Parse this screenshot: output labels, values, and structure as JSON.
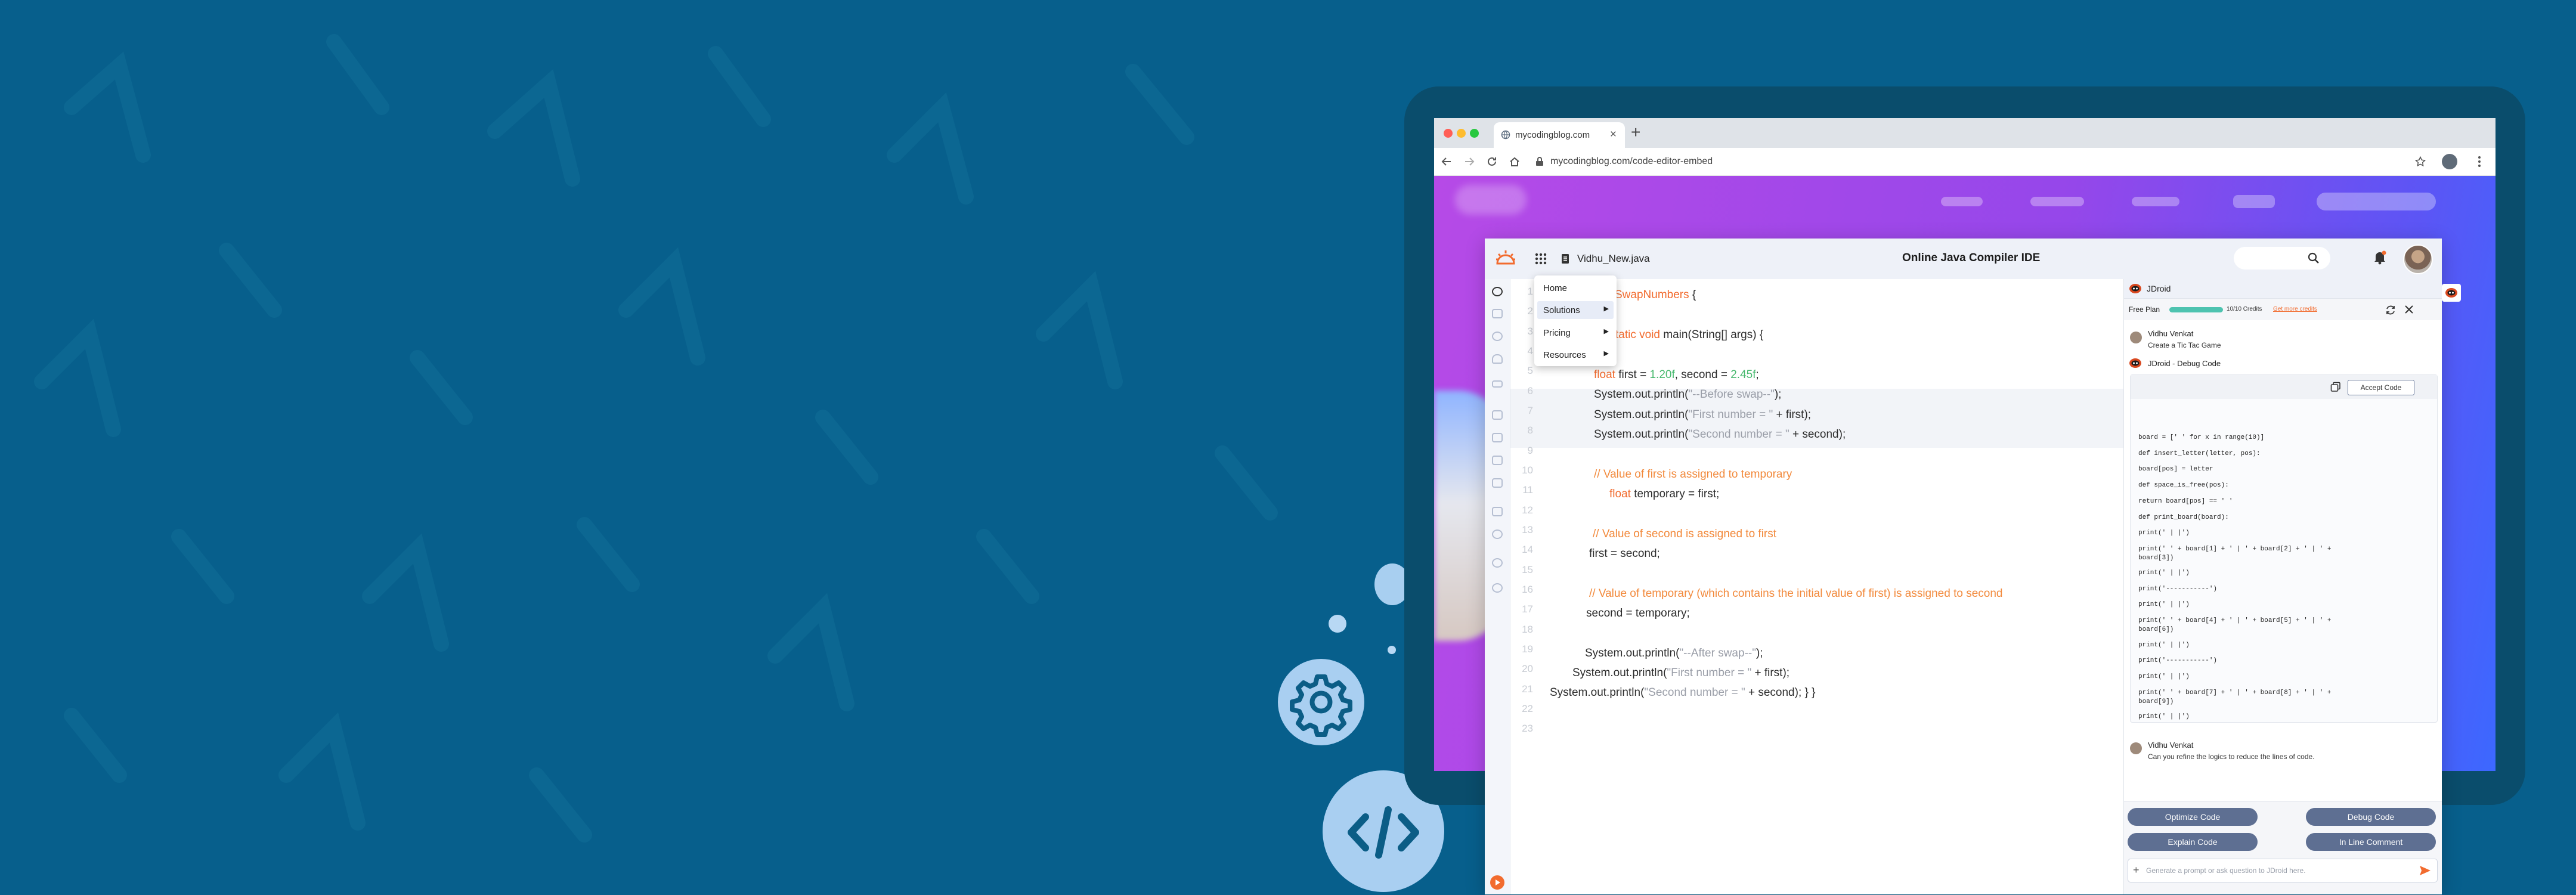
{
  "browser": {
    "tab_title": "mycodingblog.com",
    "tab_close": "×",
    "new_tab": "+",
    "url": "mycodingblog.com/code-editor-embed"
  },
  "app": {
    "file_name": "Vidhu_New.java",
    "title": "Online Java Compiler IDE"
  },
  "menu": {
    "items": [
      {
        "label": "Home",
        "has_sub": false
      },
      {
        "label": "Solutions",
        "has_sub": true
      },
      {
        "label": "Pricing",
        "has_sub": true
      },
      {
        "label": "Resources",
        "has_sub": true
      }
    ]
  },
  "editor": {
    "line_numbers": [
      "1",
      "2",
      "3",
      "4",
      "5",
      "6",
      "7",
      "8",
      "9",
      "10",
      "11",
      "12",
      "13",
      "14",
      "15",
      "16",
      "17",
      "18",
      "19",
      "20",
      "21",
      "22",
      "23"
    ],
    "code": {
      "l1_kw": "SwapNumbers",
      "l1_rest": " {",
      "l3_kw": "tatic void",
      "l3_rest": " main(String[] args) {",
      "l5_kw": "float",
      "l5_a": " first = ",
      "l5_n1": "1.20f",
      "l5_b": ", second = ",
      "l5_n2": "2.45f",
      "l5_c": ";",
      "l6_a": "System.out.println(",
      "l6_s": "\"--Before swap--\"",
      "l6_b": ");",
      "l7_a": "System.out.println(",
      "l7_s": "\"First number = \"",
      "l7_b": " + first);",
      "l8_a": "System.out.println(",
      "l8_s": "\"Second number = \"",
      "l8_b": " + second);",
      "c1": "// Value of first is assigned to temporary",
      "l11_kw": "float",
      "l11_rest": " temporary = first;",
      "c2": "// Value of second is assigned to first",
      "l14": "first = second;",
      "c3": "// Value of temporary (which contains the initial value of first) is assigned to second",
      "l17": "second = temporary;",
      "l19_a": "System.out.println(",
      "l19_s": "\"--After swap--\"",
      "l19_b": ");",
      "l20_a": "System.out.println(",
      "l20_s": "\"First number = \"",
      "l20_b": " + first);",
      "l21_a": "System.out.println(",
      "l21_s": "\"Second number = \"",
      "l21_b": " + second); } }"
    }
  },
  "jdroid": {
    "title": "JDroid",
    "plan": "Free Plan",
    "credits": "10/10 Credits",
    "credits_fraction": 1.0,
    "get_more": "Get more credits",
    "user_name": "Vidhu Venkat",
    "user_prompt": "Create a Tic Tac Game",
    "debug_title": "JDroid - Debug Code",
    "accept_label": "Accept Code",
    "code_lines": [
      "board = [' ' for x in range(10)]",
      "def insert_letter(letter, pos):",
      "board[pos] = letter",
      "def space_is_free(pos):",
      "return board[pos] == ' '",
      "def print_board(board):",
      "print(' | |')",
      "print(' ' + board[1] + ' | ' + board[2] + ' | ' +\nboard[3])",
      "print(' | |')",
      "print('-----------')",
      "print(' | |')",
      "print(' ' + board[4] + ' | ' + board[5] + ' | ' +\nboard[6])",
      "print(' | |')",
      "print('-----------')",
      "print(' | |')",
      "print(' ' + board[7] + ' | ' + board[8] + ' | ' +\nboard[9])",
      "print(' | |')"
    ],
    "user2_name": "Vidhu Venkat",
    "user2_prompt": "Can you refine the logics to reduce the lines of code.",
    "buttons": [
      "Optimize Code",
      "Debug Code",
      "Explain Code",
      "In Line Comment"
    ],
    "input_placeholder": "Generate a prompt or ask question to JDroid here.",
    "add_symbol": "+"
  },
  "colors": {
    "background": "#075f8c",
    "accent_orange": "#f26b2e",
    "button": "#5e6f92",
    "site_gradient_start": "#b64ae7",
    "site_gradient_end": "#3c68ff"
  },
  "icons": [
    "globe-icon",
    "lock-icon",
    "star-icon",
    "menu-dots-icon",
    "back-icon",
    "forward-icon",
    "reload-icon",
    "home-icon",
    "grid-icon",
    "file-icon",
    "search-icon",
    "bell-icon",
    "avatar",
    "robot-icon",
    "refresh-icon",
    "close-icon",
    "copy-icon",
    "send-icon",
    "run-icon",
    "gear-icon",
    "code-icon"
  ]
}
